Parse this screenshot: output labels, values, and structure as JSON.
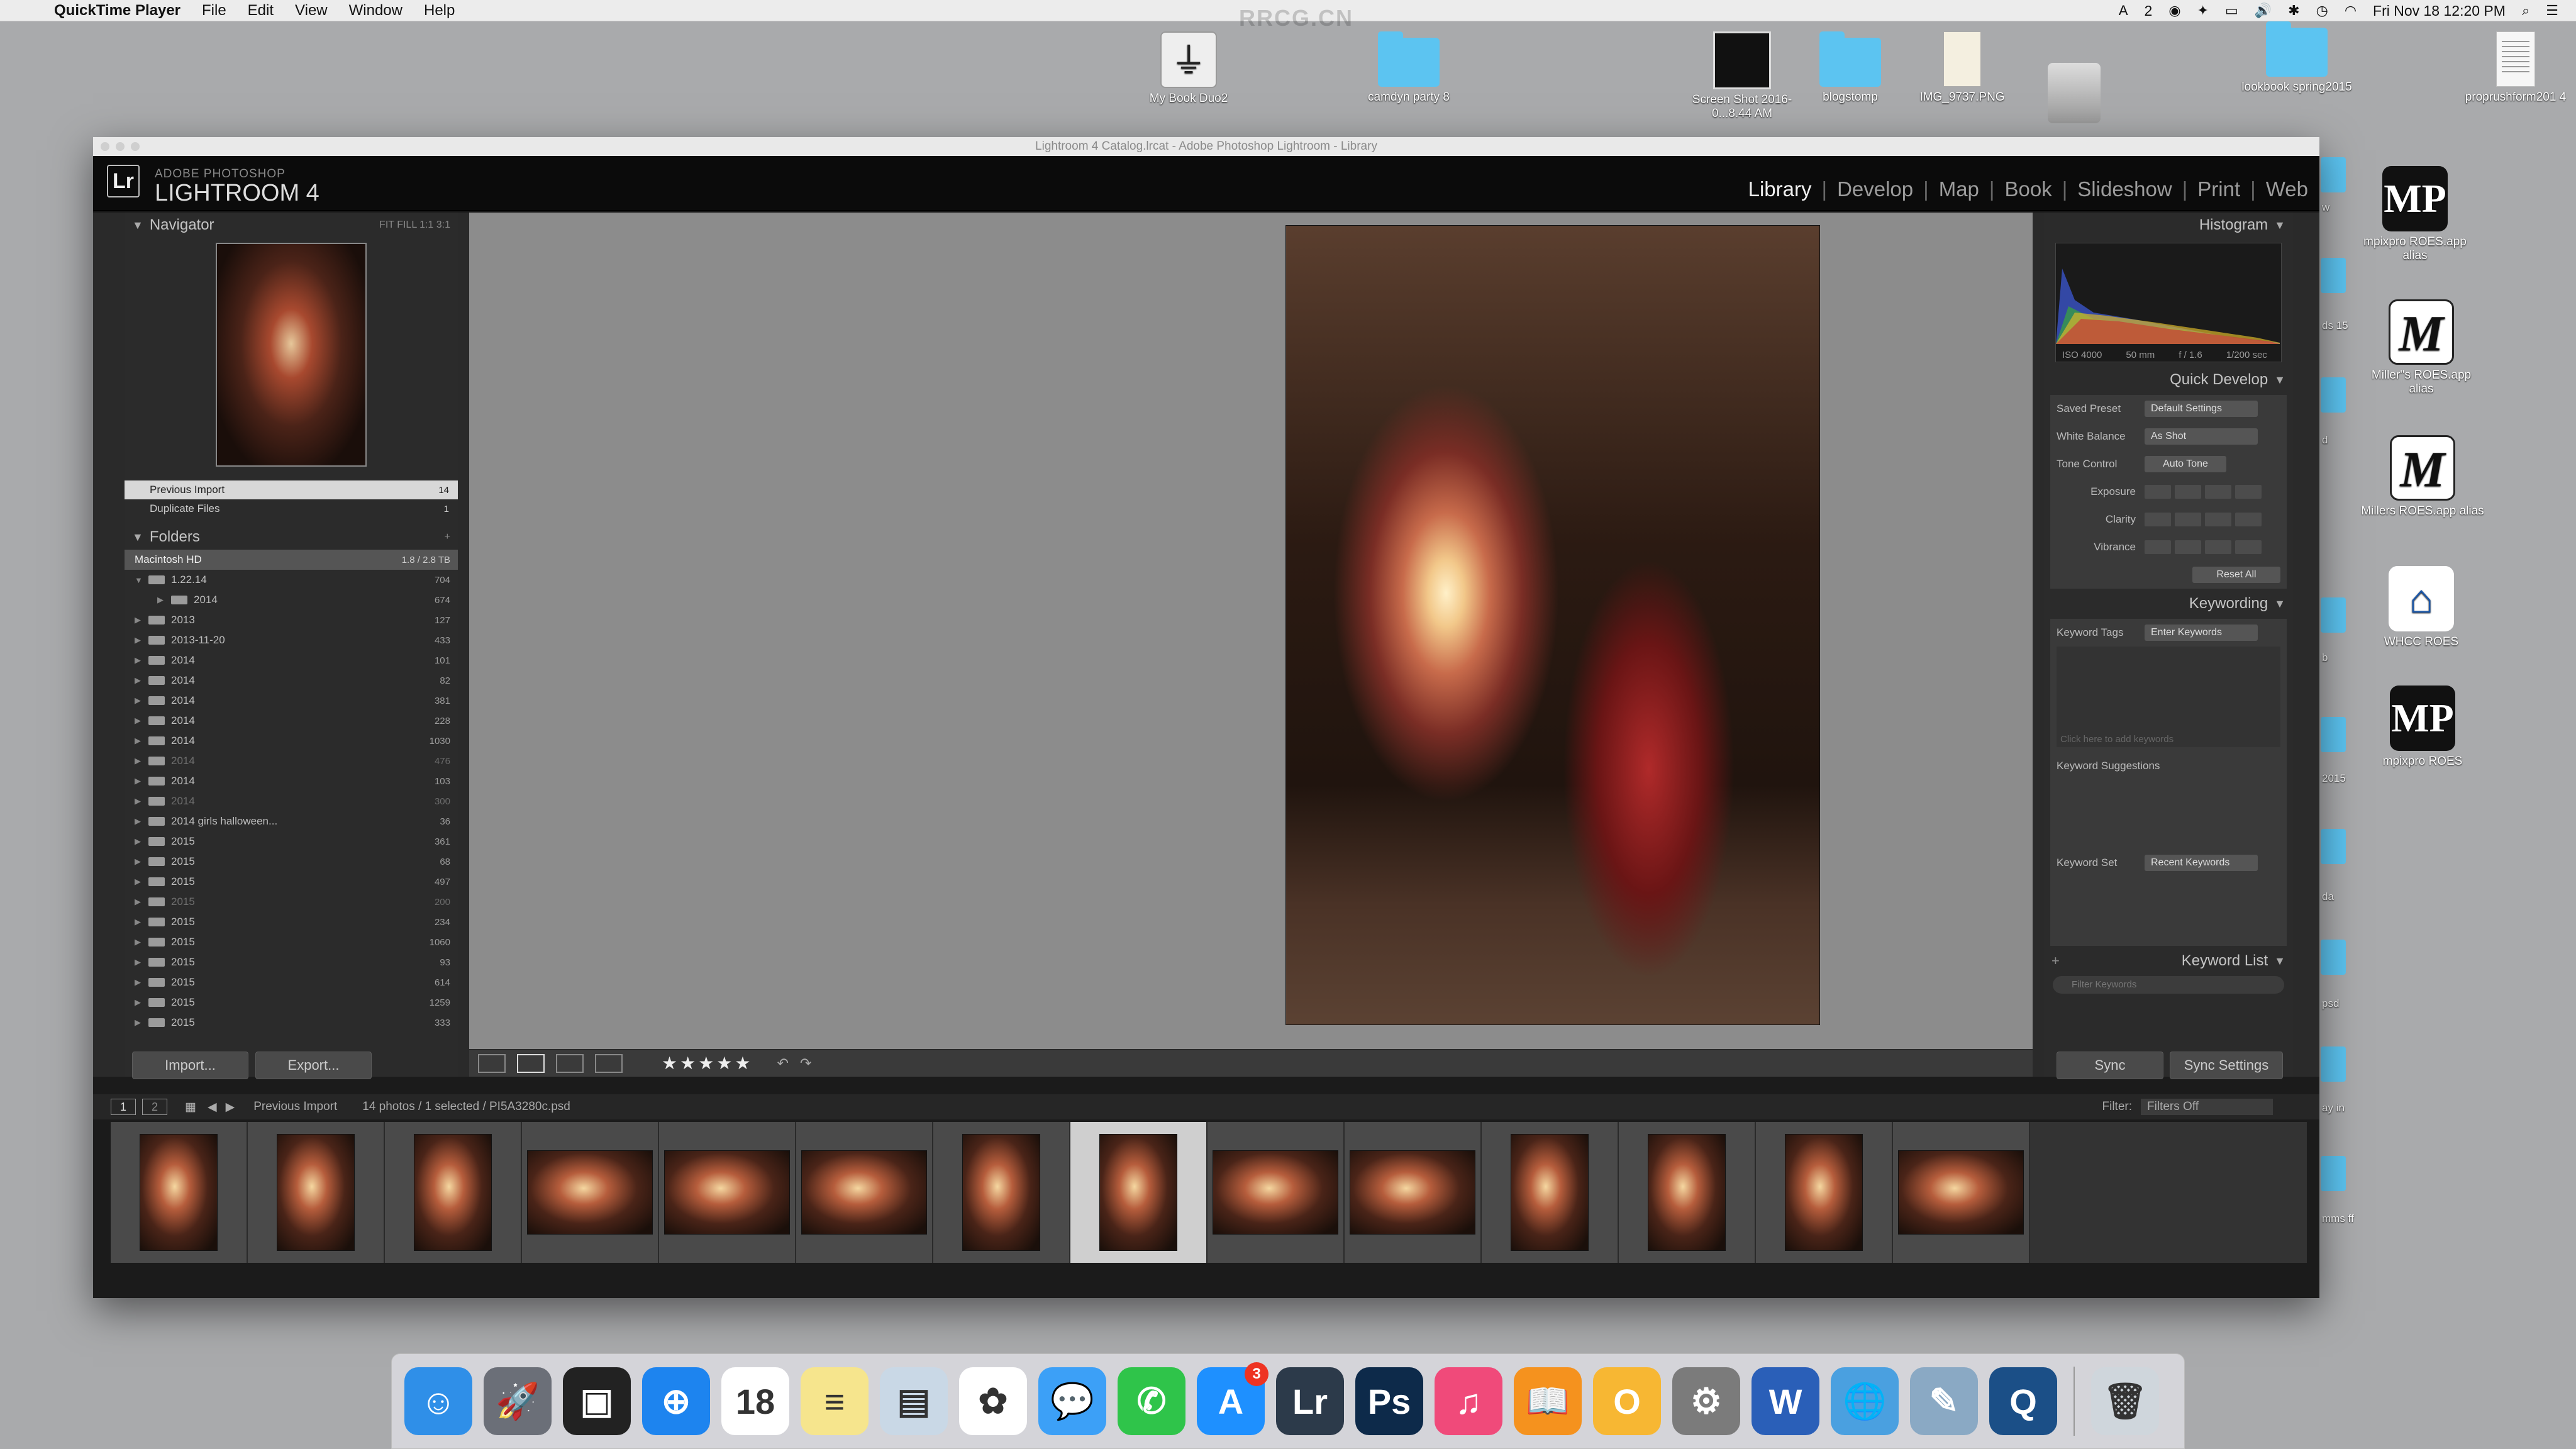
{
  "menubar": {
    "app": "QuickTime Player",
    "items": [
      "File",
      "Edit",
      "View",
      "Window",
      "Help"
    ],
    "status_icons": [
      "adobe-icon",
      "dropbox-icon",
      "airplay-icon",
      "volume-icon",
      "bluetooth-icon",
      "time-machine-icon",
      "wifi-icon"
    ],
    "adobe_count": "2",
    "clock": "Fri Nov 18  12:20 PM"
  },
  "watermark": "RRCG.CN",
  "desktop": {
    "icons": [
      {
        "label": "My Book Duo2",
        "type": "usb-icon"
      },
      {
        "label": "camdyn party 8",
        "type": "folder-icon"
      },
      {
        "label": "Screen Shot 2016-0...8.44 AM",
        "type": "screenshot-icon"
      },
      {
        "label": "blogstomp",
        "type": "folder-icon"
      },
      {
        "label": "IMG_9737.PNG",
        "type": "image-file-icon"
      },
      {
        "label": "lookbook spring2015",
        "type": "folder-icon"
      },
      {
        "label": "proprushform201 4",
        "type": "document-icon"
      },
      {
        "label": "mpixpro ROES.app alias",
        "type": "mp-icon"
      },
      {
        "label": "Miller''s ROES.app alias",
        "type": "millers-icon"
      },
      {
        "label": "Millers ROES.app alias",
        "type": "millers-icon"
      },
      {
        "label": "WHCC ROES",
        "type": "house-icon"
      },
      {
        "label": "mpixpro ROES",
        "type": "mp-icon"
      }
    ],
    "edge_labels": [
      "w",
      "ds 15",
      "d",
      "b",
      "2015",
      "da",
      "psd",
      "ay in",
      "mms ff"
    ]
  },
  "window": {
    "title": "Lightroom 4 Catalog.lrcat - Adobe Photoshop Lightroom - Library"
  },
  "lightroom": {
    "logo": "Lr",
    "brand_small": "ADOBE PHOTOSHOP",
    "brand": "LIGHTROOM 4",
    "modules": [
      "Library",
      "Develop",
      "Map",
      "Book",
      "Slideshow",
      "Print",
      "Web"
    ],
    "active_module": "Library",
    "navigator": {
      "title": "Navigator",
      "zoom": "FIT  FILL  1:1  3:1"
    },
    "catalog": [
      {
        "label": "Previous Import",
        "count": "14",
        "selected": true
      },
      {
        "label": "Duplicate Files",
        "count": "1",
        "selected": false
      }
    ],
    "folders": {
      "title": "Folders",
      "volume": "Macintosh HD",
      "volume_info": "1.8 / 2.8 TB",
      "rows": [
        {
          "label": "1.22.14",
          "count": "704",
          "open": true,
          "dim": false
        },
        {
          "label": "2014",
          "count": "674",
          "open": false,
          "dim": false,
          "indent": true
        },
        {
          "label": "2013",
          "count": "127",
          "dim": false
        },
        {
          "label": "2013-11-20",
          "count": "433",
          "dim": false
        },
        {
          "label": "2014",
          "count": "101",
          "dim": false
        },
        {
          "label": "2014",
          "count": "82",
          "dim": false
        },
        {
          "label": "2014",
          "count": "381",
          "dim": false
        },
        {
          "label": "2014",
          "count": "228",
          "dim": false
        },
        {
          "label": "2014",
          "count": "1030",
          "dim": false
        },
        {
          "label": "2014",
          "count": "476",
          "dim": true
        },
        {
          "label": "2014",
          "count": "103",
          "dim": false
        },
        {
          "label": "2014",
          "count": "300",
          "dim": true
        },
        {
          "label": "2014 girls halloween...",
          "count": "36",
          "dim": false
        },
        {
          "label": "2015",
          "count": "361",
          "dim": false
        },
        {
          "label": "2015",
          "count": "68",
          "dim": false
        },
        {
          "label": "2015",
          "count": "497",
          "dim": false
        },
        {
          "label": "2015",
          "count": "200",
          "dim": true
        },
        {
          "label": "2015",
          "count": "234",
          "dim": false
        },
        {
          "label": "2015",
          "count": "1060",
          "dim": false
        },
        {
          "label": "2015",
          "count": "93",
          "dim": false
        },
        {
          "label": "2015",
          "count": "614",
          "dim": false
        },
        {
          "label": "2015",
          "count": "1259",
          "dim": false
        },
        {
          "label": "2015",
          "count": "333",
          "dim": false
        }
      ]
    },
    "import_label": "Import...",
    "export_label": "Export...",
    "histogram": {
      "title": "Histogram",
      "iso": "ISO 4000",
      "focal": "50 mm",
      "aperture": "f / 1.6",
      "shutter": "1/200 sec"
    },
    "quick_develop": {
      "title": "Quick Develop",
      "saved_preset_label": "Saved Preset",
      "saved_preset_value": "Default Settings",
      "white_balance_label": "White Balance",
      "white_balance_value": "As Shot",
      "tone_control_label": "Tone Control",
      "tone_control_value": "Auto Tone",
      "exposure_label": "Exposure",
      "clarity_label": "Clarity",
      "vibrance_label": "Vibrance",
      "reset_label": "Reset All"
    },
    "keywording": {
      "title": "Keywording",
      "tags_label": "Keyword Tags",
      "tags_value": "Enter Keywords",
      "placeholder": "Click here to add keywords",
      "suggestions_label": "Keyword Suggestions",
      "set_label": "Keyword Set",
      "set_value": "Recent Keywords"
    },
    "keyword_list": {
      "title": "Keyword List",
      "filter_placeholder": "Filter Keywords"
    },
    "sync_label": "Sync",
    "sync_settings_label": "Sync Settings",
    "toolbar": {
      "stars": "★★★★★"
    },
    "filmstrip_bar": {
      "page1": "1",
      "page2": "2",
      "source": "Previous Import",
      "status": "14 photos / 1 selected / PI5A3280c.psd",
      "filter_label": "Filter:",
      "filter_value": "Filters Off"
    },
    "filmstrip": {
      "orientations": [
        "p",
        "p",
        "p",
        "l",
        "l",
        "l",
        "p",
        "p",
        "l",
        "l",
        "p",
        "p",
        "p",
        "l"
      ],
      "selected_index": 7
    }
  },
  "dock": {
    "apps": [
      {
        "name": "finder-icon",
        "glyph": "☺",
        "color": "#2f8fe8"
      },
      {
        "name": "launchpad-icon",
        "glyph": "🚀",
        "color": "#6b6f78"
      },
      {
        "name": "photo-browser-icon",
        "glyph": "▣",
        "color": "#222"
      },
      {
        "name": "safari-icon",
        "glyph": "⊕",
        "color": "#1d84ef"
      },
      {
        "name": "calendar-icon",
        "glyph": "18",
        "color": "#ffffff"
      },
      {
        "name": "notes-icon",
        "glyph": "≡",
        "color": "#f6e58d"
      },
      {
        "name": "preview-icon",
        "glyph": "▤",
        "color": "#c9d8e6"
      },
      {
        "name": "photos-icon",
        "glyph": "✿",
        "color": "#ffffff"
      },
      {
        "name": "messages-icon",
        "glyph": "💬",
        "color": "#3ca0f7"
      },
      {
        "name": "facetime-icon",
        "glyph": "✆",
        "color": "#2fc44a"
      },
      {
        "name": "app-store-icon",
        "glyph": "A",
        "color": "#1e90ff",
        "badge": "3"
      },
      {
        "name": "lightroom-icon",
        "glyph": "Lr",
        "color": "#2c3a4a"
      },
      {
        "name": "photoshop-icon",
        "glyph": "Ps",
        "color": "#0d2a4a"
      },
      {
        "name": "itunes-icon",
        "glyph": "♫",
        "color": "#f04a7a"
      },
      {
        "name": "ibooks-icon",
        "glyph": "📖",
        "color": "#f5921e"
      },
      {
        "name": "o-app-icon",
        "glyph": "O",
        "color": "#f7b733"
      },
      {
        "name": "system-preferences-icon",
        "glyph": "⚙",
        "color": "#7b7b7b"
      },
      {
        "name": "word-icon",
        "glyph": "W",
        "color": "#2a5fb8"
      },
      {
        "name": "network-icon",
        "glyph": "🌐",
        "color": "#4aa0e0"
      },
      {
        "name": "utility-icon",
        "glyph": "✎",
        "color": "#8aa9c4"
      },
      {
        "name": "quicktime-icon",
        "glyph": "Q",
        "color": "#1b4f87"
      }
    ],
    "trash": {
      "name": "trash-icon",
      "glyph": "🗑",
      "color": "#cfd6dc"
    }
  }
}
